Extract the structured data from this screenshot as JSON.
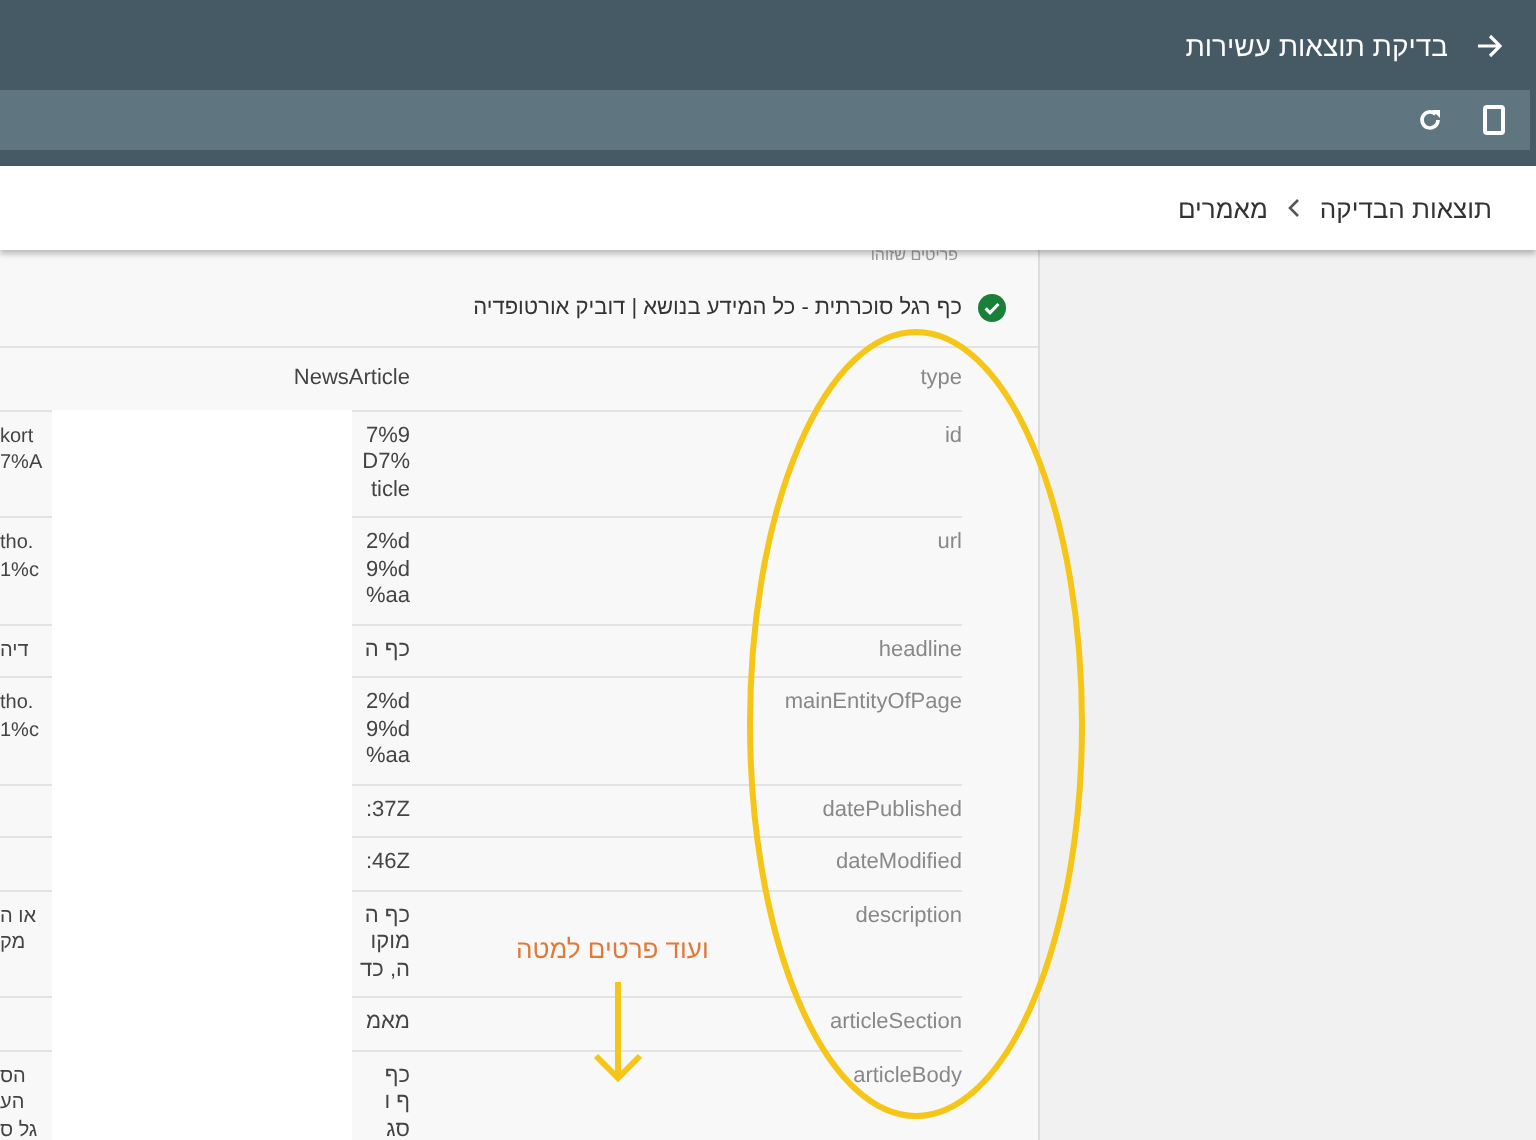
{
  "app_bar": {
    "title": "בדיקת תוצאות עשירות"
  },
  "breadcrumb": [
    "תוצאות הבדיקה",
    "מאמרים"
  ],
  "detected_label": "פריטים שזוהו",
  "item": {
    "title": "כף רגל סוכרתית - כל המידע בנושא | דוביק אורטופדיה",
    "valid": true
  },
  "table": {
    "rows": [
      {
        "label": "type",
        "left": [],
        "right": [
          "NewsArticle"
        ]
      },
      {
        "label": "id",
        "left": [
          "kort",
          "7%A"
        ],
        "right": [
          "7%9",
          "D7%",
          "ticle"
        ]
      },
      {
        "label": "url",
        "left": [
          "tho.",
          "1%c"
        ],
        "right": [
          "2%d",
          "9%d",
          "%aa"
        ]
      },
      {
        "label": "headline",
        "left": [
          "דיה"
        ],
        "right": [
          "כף ה"
        ]
      },
      {
        "label": "mainEntityOfPage",
        "left": [
          "tho.",
          "1%c"
        ],
        "right": [
          "2%d",
          "9%d",
          "%aa"
        ]
      },
      {
        "label": "datePublished",
        "left": [],
        "right": [
          ":37Z"
        ]
      },
      {
        "label": "dateModified",
        "left": [],
        "right": [
          ":46Z"
        ]
      },
      {
        "label": "description",
        "left": [
          "או ה",
          "מק"
        ],
        "right": [
          "כף ה",
          "מוקו",
          "ה, כד"
        ]
      },
      {
        "label": "articleSection",
        "left": [],
        "right": [
          "מאמ"
        ]
      },
      {
        "label": "articleBody",
        "left": [
          "הס",
          "הע",
          "גל ס"
        ],
        "right": [
          "כף",
          "ף ו",
          "סג"
        ]
      }
    ]
  },
  "annotation": {
    "text": "ועוד פרטים למטה"
  }
}
